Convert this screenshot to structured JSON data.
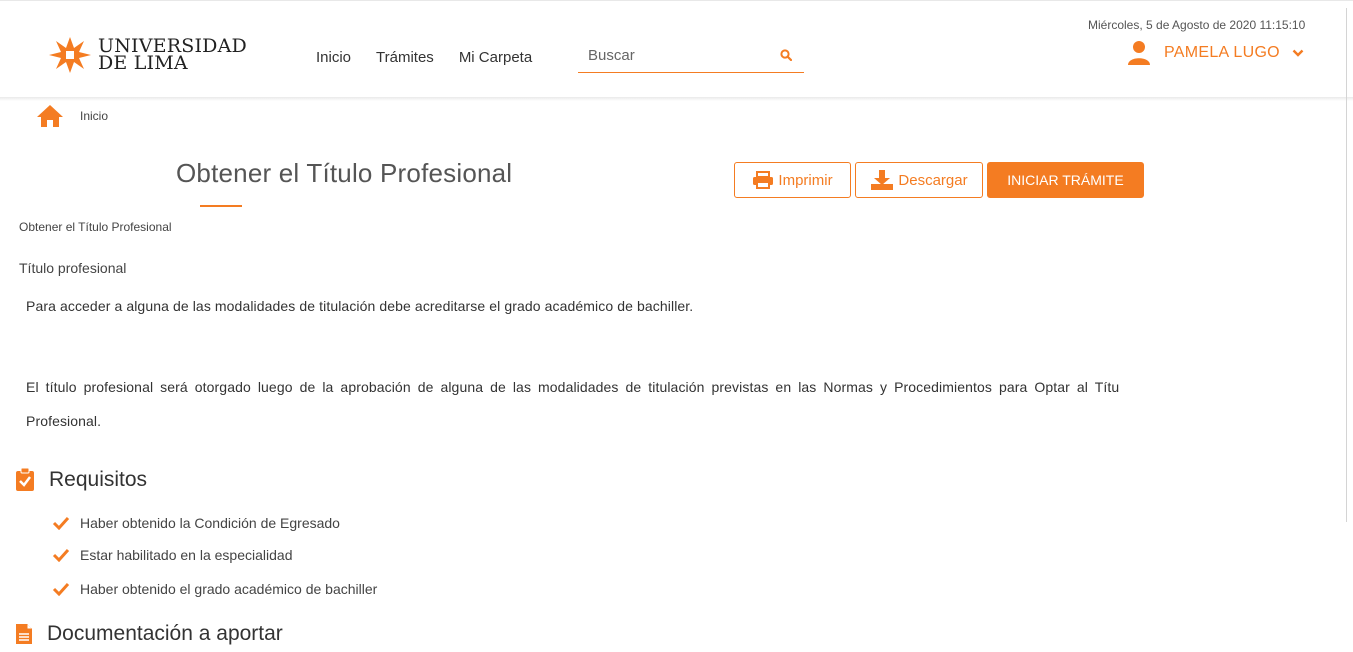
{
  "header": {
    "logo_line1": "UNIVERSIDAD",
    "logo_line2": "DE LIMA",
    "nav": [
      "Inicio",
      "Trámites",
      "Mi Carpeta"
    ],
    "search_placeholder": "Buscar",
    "datetime": "Miércoles, 5 de Agosto de 2020 11:15:10",
    "user_name": "PAMELA LUGO"
  },
  "breadcrumb": {
    "label": "Inicio"
  },
  "page": {
    "title": "Obtener el Título Profesional",
    "subtitle": "Obtener el Título Profesional",
    "section": "Título profesional",
    "paragraphs": [
      "Para acceder a alguna de las modalidades de titulación debe acreditarse el grado académico de bachiller.",
      "El título profesional será otorgado luego de la aprobación de alguna de las modalidades de titulación previstas en las Normas y Procedimientos para Optar al Títu",
      "Profesional."
    ],
    "buttons": {
      "print": "Imprimir",
      "download": "Descargar",
      "start": "INICIAR TRÁMITE"
    }
  },
  "requisitos": {
    "heading": "Requisitos",
    "items": [
      "Haber obtenido la Condición de Egresado",
      "Estar habilitado en la especialidad",
      "Haber obtenido el grado académico de bachiller"
    ]
  },
  "documentacion": {
    "heading": "Documentación a aportar"
  },
  "colors": {
    "accent": "#f47c22"
  }
}
